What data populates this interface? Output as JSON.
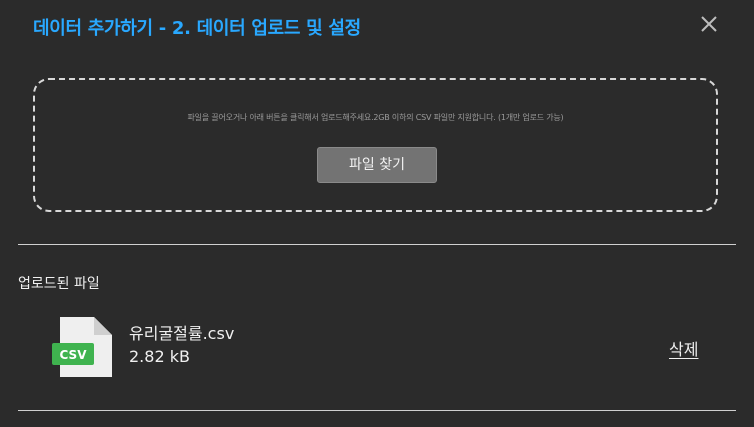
{
  "dialog": {
    "title": "데이터 추가하기 - 2. 데이터 업로드 및 설정",
    "close_icon": "close-icon"
  },
  "dropzone": {
    "hint": "파일을 끌어오거나 아래 버튼을 클릭해서 업로드해주세요.2GB 이하의 CSV 파일만 지원합니다. (1개만 업로드 가능)",
    "button_label": "파일 찾기"
  },
  "uploaded": {
    "section_label": "업로드된 파일",
    "files": [
      {
        "icon": "csv-file-icon",
        "badge": "CSV",
        "name": "유리굴절률.csv",
        "size": "2.82 kB",
        "delete_label": "삭제"
      }
    ]
  },
  "colors": {
    "accent": "#29a8ff",
    "background": "#2b2b2b",
    "csv_badge": "#3fb34f"
  }
}
